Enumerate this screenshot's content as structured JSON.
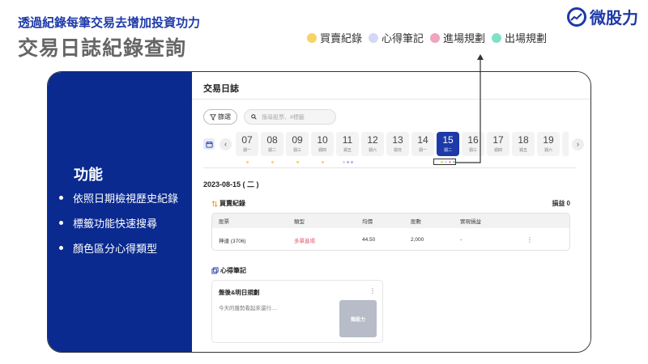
{
  "header": {
    "subtitle": "透過紀錄每筆交易去增加投資功力",
    "title": "交易日誌紀錄查詢",
    "logo_text": "微股力"
  },
  "legend": [
    {
      "label": "買賣紀錄",
      "color": "#f7d264"
    },
    {
      "label": "心得筆記",
      "color": "#d4d8f4"
    },
    {
      "label": "進場規劃",
      "color": "#f2a3bd"
    },
    {
      "label": "出場規劃",
      "color": "#7fe0c8"
    }
  ],
  "features": {
    "title": "功能",
    "items": [
      "依照日期檢視歷史紀錄",
      "標籤功能快速搜尋",
      "顏色區分心得類型"
    ]
  },
  "app": {
    "title": "交易日誌",
    "filter_label": "篩選",
    "search_placeholder": "搜尋股票、#標籤",
    "days": [
      {
        "num": "07",
        "wk": "週一",
        "dots": [
          "#f7d264"
        ]
      },
      {
        "num": "08",
        "wk": "週二",
        "dots": [
          "#f7d264"
        ]
      },
      {
        "num": "09",
        "wk": "週三",
        "dots": [
          "#f7d264"
        ]
      },
      {
        "num": "10",
        "wk": "週四",
        "dots": [
          "#f7d264"
        ]
      },
      {
        "num": "11",
        "wk": "週五",
        "dots": [
          "#d4d8f4",
          "#a9b7ea",
          "#a9b7ea"
        ]
      },
      {
        "num": "12",
        "wk": "週六",
        "dots": []
      },
      {
        "num": "13",
        "wk": "週日",
        "dots": []
      },
      {
        "num": "14",
        "wk": "週一",
        "dots": []
      },
      {
        "num": "15",
        "wk": "週二",
        "dots": [
          "#f7d264",
          "#d4d8f4",
          "#f2a3bd",
          "#7fe0c8"
        ],
        "active": true
      },
      {
        "num": "16",
        "wk": "週三",
        "dots": []
      },
      {
        "num": "17",
        "wk": "週四",
        "dots": []
      },
      {
        "num": "18",
        "wk": "週五",
        "dots": []
      },
      {
        "num": "19",
        "wk": "週六",
        "dots": []
      }
    ],
    "date_heading": "2023-08-15 ( 二 )",
    "trade_section": "買賣紀錄",
    "pl_label": "損益 0",
    "table": {
      "headers": [
        "股票",
        "類型",
        "均價",
        "股數",
        "實現損益",
        ""
      ],
      "rows": [
        {
          "stock": "神達 (3706)",
          "type": "多單進場",
          "price": "44.50",
          "shares": "2,000",
          "realized": "-",
          "more": "⋮"
        }
      ]
    },
    "notes_section": "心得筆記",
    "note": {
      "title": "盤後&明日規劃",
      "body": "今天的盤勢看起來還行....",
      "more": "⋮",
      "img_label": "微股力"
    }
  }
}
